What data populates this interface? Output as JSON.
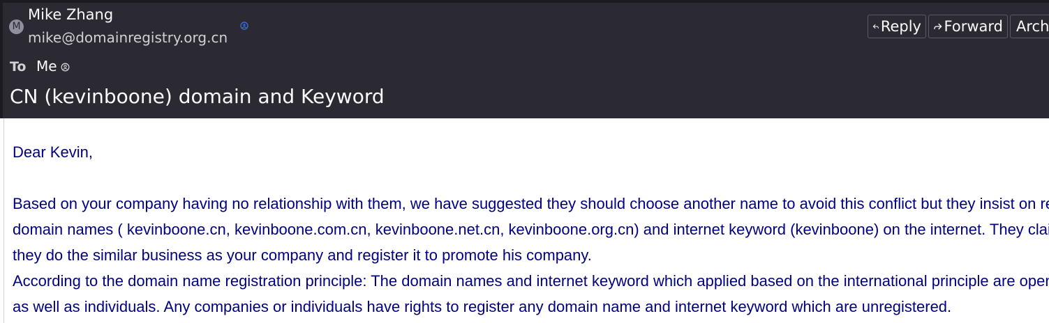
{
  "message": {
    "sender": {
      "name": "Mike Zhang",
      "email": "mike@domainregistry.org.cn",
      "avatar_letter": "M"
    },
    "to_label": "To",
    "to_value": "Me",
    "subject": "CN (kevinboone) domain and Keyword"
  },
  "toolbar": {
    "reply_label": "Reply",
    "forward_label": "Forward",
    "archive_label": "Archive"
  },
  "body": {
    "greeting": "Dear Kevin,",
    "paragraph1_lines": [
      "Based on your company having no relationship with them, we have suggested they should choose another name to avoid this conflict but they insist on registering the",
      "domain names ( kevinboone.cn, kevinboone.com.cn, kevinboone.net.cn, kevinboone.org.cn) and internet keyword (kevinboone) on the internet. They claimed",
      "they do the similar business as your company and register it to promote his company."
    ],
    "paragraph2_lines": [
      "According to the domain name registration principle: The domain names and internet keyword which applied based on the international principle are open to companies",
      "as well as individuals. Any companies or individuals have rights to register any domain name and internet keyword which are unregistered."
    ]
  },
  "colors": {
    "header_bg": "#2b2a33",
    "body_text": "#000080",
    "button_border": "#5b5b66"
  },
  "icons": {
    "avatar": "letter-avatar",
    "contact": "contact-icon",
    "me": "person-icon",
    "reply": "reply-arrow-icon",
    "forward": "forward-arrow-icon",
    "archive": "archive-box-icon"
  }
}
